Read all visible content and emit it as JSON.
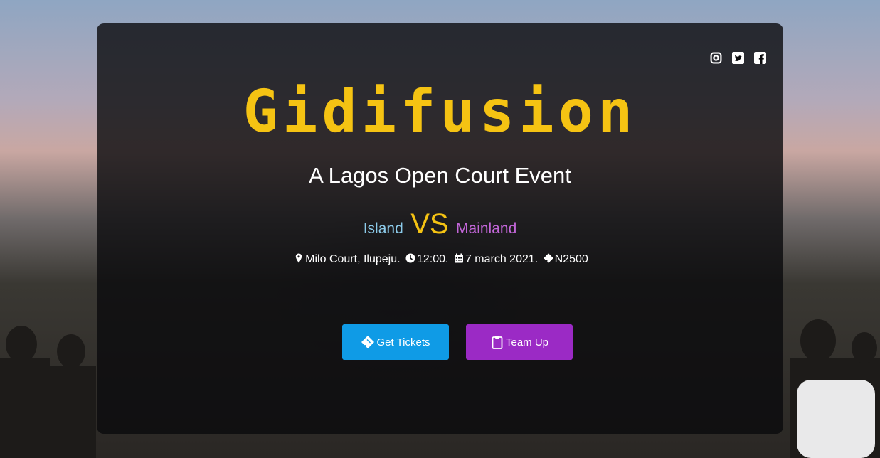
{
  "hero": {
    "title": "Gidifusion",
    "subtitle": "A Lagos Open Court Event",
    "team_a": "Island",
    "vs": "VS",
    "team_b": "Mainland",
    "venue": "Milo Court, Ilupeju.",
    "time": "12:00.",
    "date": "7 march 2021.",
    "price": "N2500"
  },
  "social": [
    {
      "icon": "instagram-icon"
    },
    {
      "icon": "twitter-icon"
    },
    {
      "icon": "facebook-icon"
    }
  ],
  "buttons": {
    "tickets_label": "Get Tickets",
    "team_label": "Team Up"
  },
  "colors": {
    "title": "#f5c313",
    "team_a": "#8ccbea",
    "team_b": "#c266d8",
    "tickets_button": "#0f9be6",
    "team_button": "#9b2ac5"
  }
}
